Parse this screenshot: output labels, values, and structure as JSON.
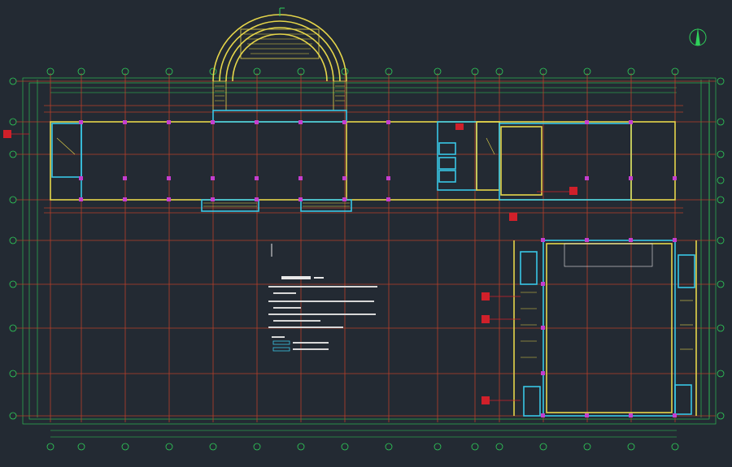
{
  "drawing": {
    "background": "#232a33",
    "colors": {
      "grid": "#b8402a",
      "wall_yellow": "#e6d64a",
      "wall_cyan": "#39c7e6",
      "dimension": "#2fd05a",
      "column": "#c53ecf",
      "text": "#e8e8e8",
      "tag": "#d0202a"
    },
    "axis_bubbles_top": [
      "1",
      "2",
      "3",
      "4",
      "5",
      "6",
      "7",
      "8",
      "9",
      "10",
      "11",
      "12",
      "13",
      "14",
      "15",
      "16"
    ],
    "axis_bubbles_left": [
      "H",
      "G",
      "F",
      "E",
      "D",
      "C",
      "B",
      "A"
    ],
    "north_arrow_icon": "north-arrow-icon"
  }
}
